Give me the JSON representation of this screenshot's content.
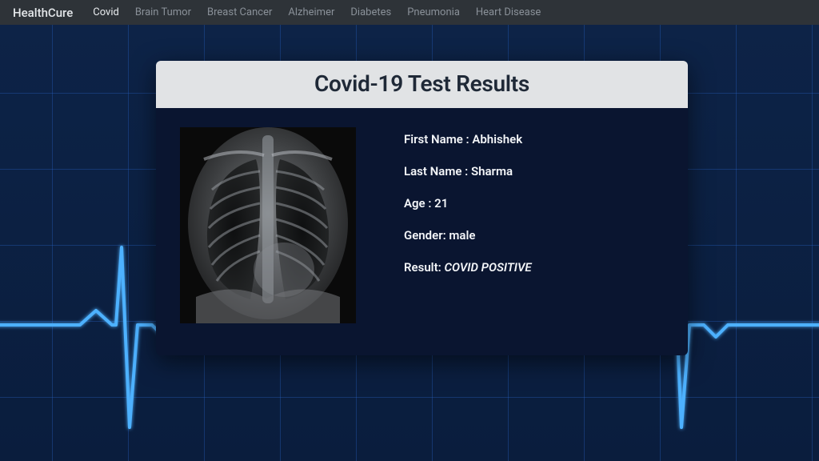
{
  "nav": {
    "brand": "HealthCure",
    "items": [
      {
        "label": "Covid",
        "active": true
      },
      {
        "label": "Brain Tumor",
        "active": false
      },
      {
        "label": "Breast Cancer",
        "active": false
      },
      {
        "label": "Alzheimer",
        "active": false
      },
      {
        "label": "Diabetes",
        "active": false
      },
      {
        "label": "Pneumonia",
        "active": false
      },
      {
        "label": "Heart Disease",
        "active": false
      }
    ]
  },
  "card": {
    "title": "Covid-19 Test Results",
    "first_name_label": "First Name : ",
    "first_name_value": "Abhishek",
    "last_name_label": "Last Name : ",
    "last_name_value": "Sharma",
    "age_label": "Age : ",
    "age_value": "21",
    "gender_label": "Gender: ",
    "gender_value": "male",
    "result_label": "Result: ",
    "result_value": "COVID POSITIVE"
  }
}
